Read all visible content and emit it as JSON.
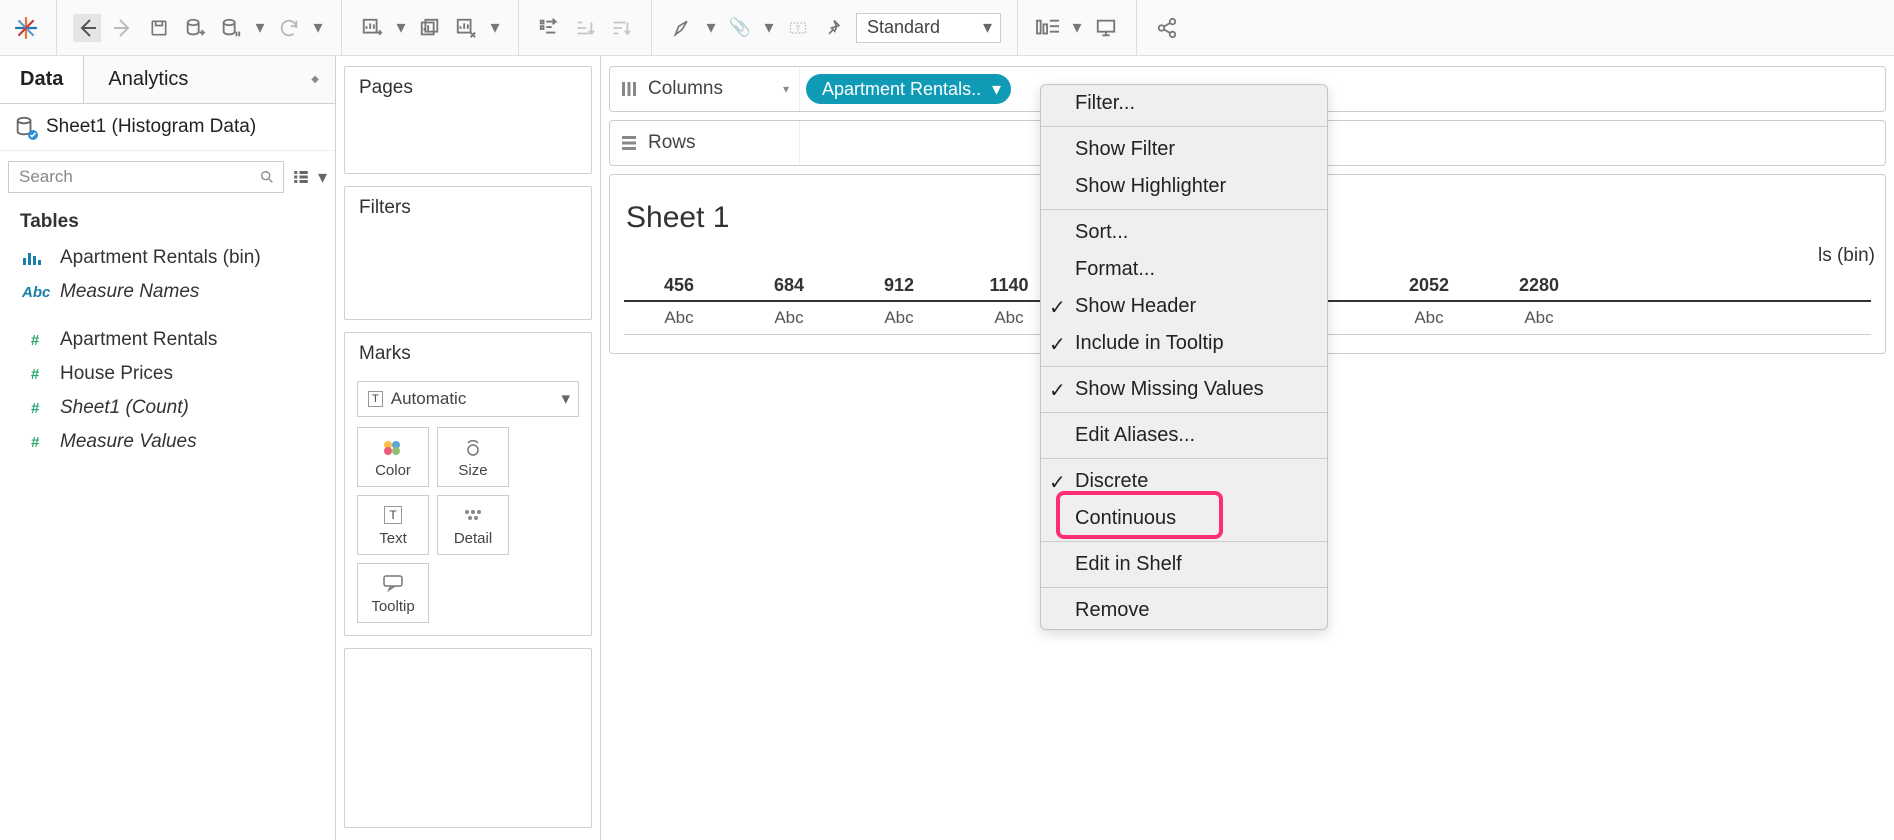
{
  "toolbar": {
    "view_mode": "Standard"
  },
  "sidebar": {
    "tabs": {
      "data": "Data",
      "analytics": "Analytics"
    },
    "datasource": "Sheet1 (Histogram Data)",
    "search_placeholder": "Search",
    "tables_header": "Tables",
    "fields": [
      {
        "icon": "bar",
        "label": "Apartment Rentals (bin)",
        "color": "blue",
        "italic": false
      },
      {
        "icon": "abc",
        "label": "Measure Names",
        "color": "blue",
        "italic": true
      },
      {
        "icon": "hash",
        "label": "Apartment Rentals",
        "color": "green",
        "italic": false
      },
      {
        "icon": "hash",
        "label": "House Prices",
        "color": "green",
        "italic": false
      },
      {
        "icon": "hash",
        "label": "Sheet1 (Count)",
        "color": "green",
        "italic": true
      },
      {
        "icon": "hash",
        "label": "Measure Values",
        "color": "green",
        "italic": true
      }
    ]
  },
  "cards": {
    "pages": "Pages",
    "filters": "Filters",
    "marks": "Marks",
    "mark_type": "Automatic",
    "mark_cells": {
      "color": "Color",
      "size": "Size",
      "text": "Text",
      "detail": "Detail",
      "tooltip": "Tooltip"
    }
  },
  "shelves": {
    "columns": "Columns",
    "rows": "Rows",
    "pill": "Apartment Rentals.."
  },
  "sheet": {
    "title": "Sheet 1",
    "right_header": "ls (bin)",
    "headers": [
      "456",
      "684",
      "912",
      "1140",
      "2052",
      "2280"
    ],
    "abc": "Abc"
  },
  "context_menu": {
    "filter": "Filter...",
    "show_filter": "Show Filter",
    "show_highlighter": "Show Highlighter",
    "sort": "Sort...",
    "format": "Format...",
    "show_header": "Show Header",
    "include_tooltip": "Include in Tooltip",
    "show_missing": "Show Missing Values",
    "edit_aliases": "Edit Aliases...",
    "discrete": "Discrete",
    "continuous": "Continuous",
    "edit_in_shelf": "Edit in Shelf",
    "remove": "Remove"
  }
}
